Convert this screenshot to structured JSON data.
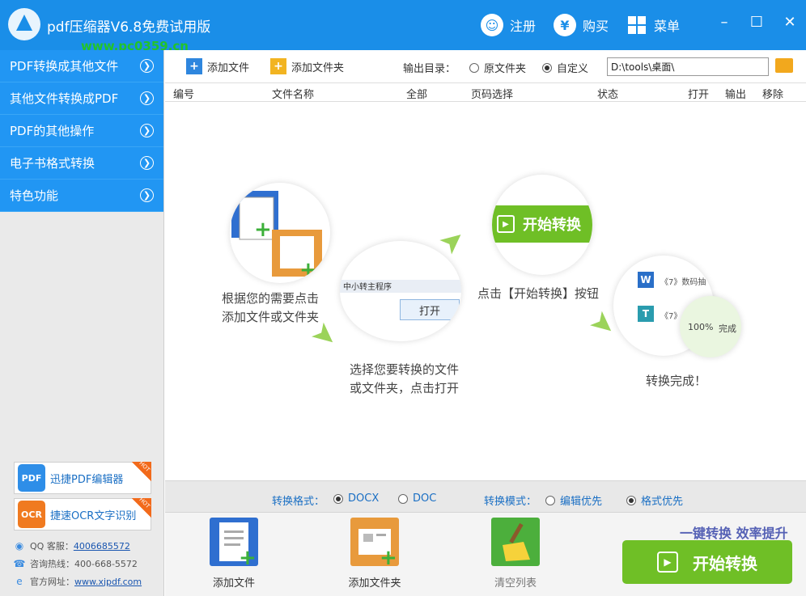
{
  "title_bar": {
    "title": "pdf压缩器V6.8免费试用版",
    "watermark": "www.pc0359.cn",
    "register_label": "注册",
    "buy_label": "购买",
    "menu_label": "菜单",
    "bg_color": "#1a8ee8"
  },
  "sidebar": {
    "items": [
      {
        "label": "PDF转换成其他文件"
      },
      {
        "label": "其他文件转换成PDF"
      },
      {
        "label": "PDF的其他操作"
      },
      {
        "label": "电子书格式转换"
      },
      {
        "label": "特色功能"
      }
    ],
    "promo1": "迅捷PDF编辑器",
    "promo2": "捷速OCR文字识别",
    "promo1_icon": "PDF",
    "promo2_icon": "OCR",
    "hot": "HOT",
    "qq_label": "QQ 客服：",
    "qq_value": "4006685572",
    "hotline": "咨询热线：400-668-5572",
    "site_label": "官方网址：",
    "site_value": "www.xjpdf.com"
  },
  "toolbar": {
    "add_file": "添加文件",
    "add_folder": "添加文件夹",
    "output_label": "输出目录：",
    "option_original": "原文件夹",
    "option_custom": "自定义",
    "path_value": "D:\\tools\\桌面\\"
  },
  "table_header": {
    "col_index": "编号",
    "col_name": "文件名称",
    "col_all": "全部",
    "col_pages": "页码选择",
    "col_status": "状态",
    "col_open": "打开",
    "col_output": "输出",
    "col_remove": "移除"
  },
  "guide": {
    "step1": [
      "根据您的需要点击",
      "添加文件或文件夹"
    ],
    "step2": [
      "选择您要转换的文件",
      "或文件夹，点击打开"
    ],
    "step3": "点击【开始转换】按钮",
    "step4": "转换完成！",
    "open_btn": "打开",
    "start_label": "开始转换",
    "dialog_text": "中小转主程序",
    "w_item": "《7》数码抽",
    "t_item": "《7》",
    "pct": "100%",
    "done": "完成"
  },
  "options": {
    "format_label": "转换格式：",
    "docx": "DOCX",
    "doc": "DOC",
    "mode_label": "转换模式：",
    "edit_first": "编辑优先",
    "format_first": "格式优先"
  },
  "actions": {
    "add_file": "添加文件",
    "add_folder": "添加文件夹",
    "clear_list": "清空列表",
    "slogan": "一键转换  效率提升",
    "start": "开始转换"
  }
}
